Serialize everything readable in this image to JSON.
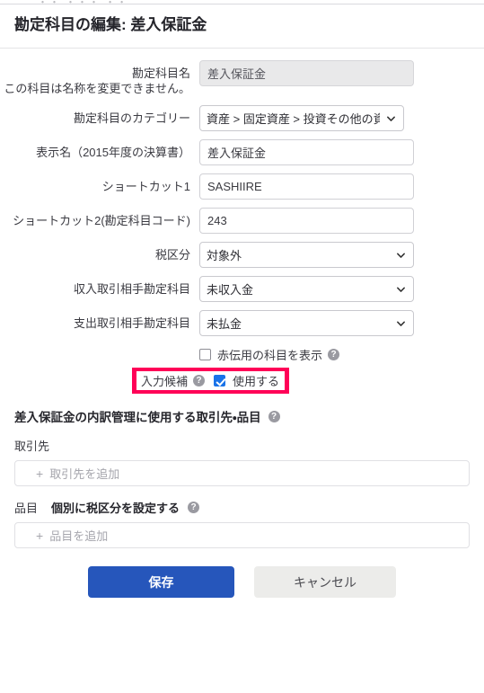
{
  "top_strip": {
    "ghost_text": "・・  ・・・  ・・"
  },
  "header": {
    "title": "勘定科目の編集: 差入保証金"
  },
  "form": {
    "fields": [
      {
        "label": "勘定科目名",
        "sublabel": "この科目は名称を変更できません。",
        "type": "text",
        "value": "差入保証金",
        "disabled": true
      },
      {
        "label": "勘定科目のカテゴリー",
        "type": "select",
        "value": "資産 > 固定資産 > 投資その他の資"
      },
      {
        "label": "表示名（2015年度の決算書）",
        "type": "text",
        "value": "差入保証金"
      },
      {
        "label": "ショートカット1",
        "type": "text",
        "value": "SASHIIRE"
      },
      {
        "label": "ショートカット2(勘定科目コード)",
        "type": "text",
        "value": "243"
      },
      {
        "label": "税区分",
        "type": "select",
        "value": "対象外"
      },
      {
        "label": "収入取引相手勘定科目",
        "type": "select",
        "value": "未収入金"
      },
      {
        "label": "支出取引相手勘定科目",
        "type": "select",
        "value": "未払金"
      }
    ],
    "red_slip_checkbox": {
      "label": "赤伝用の科目を表示",
      "checked": false,
      "help": "?"
    },
    "suggestion_row": {
      "label": "入力候補",
      "help": "?",
      "checkbox_label": "使用する",
      "checked": true,
      "highlight_color": "#ff0057"
    }
  },
  "breakdown": {
    "heading": "差入保証金の内訳管理に使用する取引先・品目",
    "heading_help": "?",
    "partner": {
      "label": "取引先",
      "add_placeholder": "取引先を追加",
      "plus": "+"
    },
    "item": {
      "label": "品目",
      "link_label": "個別に税区分を設定する",
      "help": "?",
      "add_placeholder": "品目を追加",
      "plus": "+"
    }
  },
  "actions": {
    "save_label": "保存",
    "cancel_label": "キャンセル",
    "save_color": "#2656bb"
  }
}
